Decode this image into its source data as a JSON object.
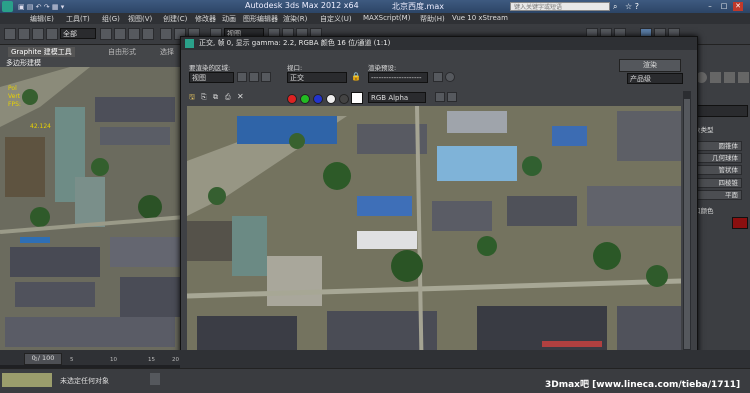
{
  "window": {
    "title": "Autodesk 3ds Max  2012 x64",
    "filename": "北京西度.max",
    "search_placeholder": "键入关键字或短语"
  },
  "menu": [
    "编辑(E)",
    "工具(T)",
    "组(G)",
    "视图(V)",
    "创建(C)",
    "修改器",
    "动画",
    "图形编辑器",
    "渲染(R)",
    "自定义(U)",
    "MAXScript(M)",
    "帮助(H)",
    "Vue 10 xStream"
  ],
  "toolbar": {
    "selection_filter": "全部",
    "ref_coord": "视图"
  },
  "ribbon": {
    "title": "Graphite 建模工具",
    "tab2": "自由形式",
    "tab3": "选择",
    "subtab": "多边形建模"
  },
  "viewport": {
    "overlay_lines": [
      "Pol",
      "Vert",
      "FPS:"
    ],
    "overlay_value": "42.124"
  },
  "render_window": {
    "title": "正交, 帧 0, 显示 gamma: 2.2, RGBA 颜色 16 位/通道 (1:1)",
    "area_label": "要渲染的区域:",
    "area_value": "视图",
    "viewport_label": "视口:",
    "viewport_value": "正交",
    "preset_label": "渲染预设:",
    "preset_value": "--------------------",
    "render_button": "渲染",
    "product_value": "产品级",
    "channel_value": "RGB Alpha"
  },
  "command_panel": {
    "items": [
      "象类型",
      "圆锥体",
      "几何球体",
      "管状体",
      "四棱锥",
      "平面",
      "和颜色"
    ]
  },
  "timeline": {
    "frame": "0 / 100",
    "ticks": [
      "0",
      "5",
      "10",
      "15",
      "20"
    ]
  },
  "status": {
    "message": "未选定任何对象"
  },
  "watermark": "3Dmax吧 [www.lineca.com/tieba/1711]"
}
